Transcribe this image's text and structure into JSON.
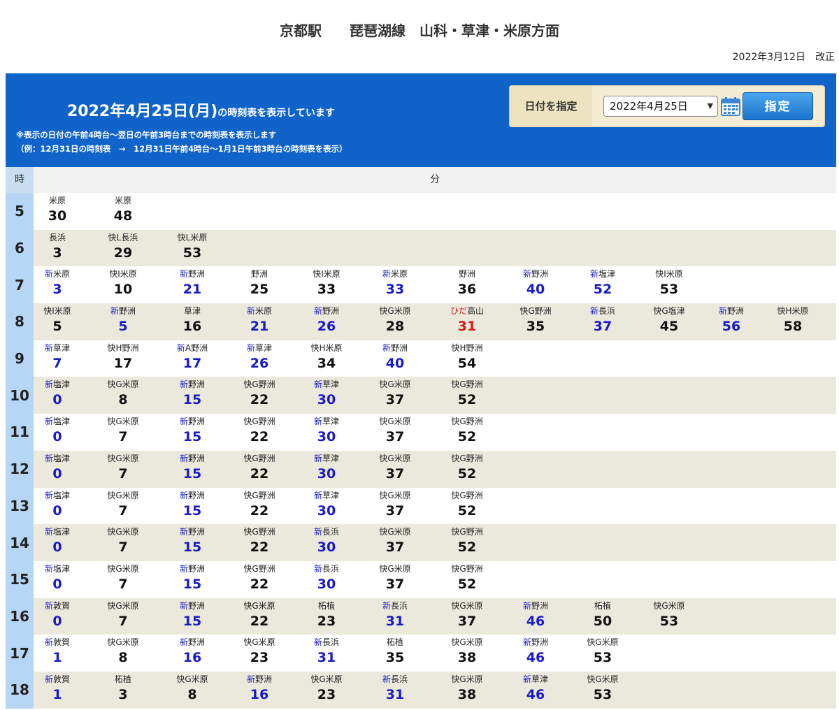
{
  "header": {
    "title": "京都駅　　琵琶湖線　山科・草津・米原方面",
    "revised": "2022年3月12日　改正"
  },
  "banner": {
    "date_big": "2022年4月25日(月)",
    "date_suffix": "の時刻表を表示しています",
    "note1": "※表示の日付の午前4時台〜翌日の午前3時台までの時刻表を表示します",
    "note2": "（例：12月31日の時刻表　→　12月31日午前4時台〜1月1日午前3時台の時刻表を表示）",
    "date_label": "日付を指定",
    "selected_date": "2022年4月25日",
    "submit_label": "指定",
    "calendar_icon": "calendar-icon"
  },
  "table": {
    "hour_header": "時",
    "minute_header": "分",
    "rows": [
      {
        "hour": "5",
        "trains": [
          {
            "pre": "",
            "dest": "米原",
            "min": "30",
            "c": ""
          },
          {
            "pre": "",
            "dest": "米原",
            "min": "48",
            "c": ""
          }
        ]
      },
      {
        "hour": "6",
        "trains": [
          {
            "pre": "",
            "dest": "長浜",
            "min": "3",
            "c": ""
          },
          {
            "pre": "",
            "dest": "快L長浜",
            "min": "29",
            "c": ""
          },
          {
            "pre": "",
            "dest": "快L米原",
            "min": "53",
            "c": ""
          }
        ]
      },
      {
        "hour": "7",
        "trains": [
          {
            "pre": "新",
            "dest": "米原",
            "min": "3",
            "c": "blue"
          },
          {
            "pre": "",
            "dest": "快I米原",
            "min": "10",
            "c": ""
          },
          {
            "pre": "新",
            "dest": "野洲",
            "min": "21",
            "c": "blue"
          },
          {
            "pre": "",
            "dest": "野洲",
            "min": "25",
            "c": ""
          },
          {
            "pre": "",
            "dest": "快I米原",
            "min": "33",
            "c": ""
          },
          {
            "pre": "新",
            "dest": "米原",
            "min": "33",
            "c": "blue"
          },
          {
            "pre": "",
            "dest": "野洲",
            "min": "36",
            "c": ""
          },
          {
            "pre": "新",
            "dest": "野洲",
            "min": "40",
            "c": "blue"
          },
          {
            "pre": "新",
            "dest": "塩津",
            "min": "52",
            "c": "blue"
          },
          {
            "pre": "",
            "dest": "快I米原",
            "min": "53",
            "c": ""
          }
        ]
      },
      {
        "hour": "8",
        "trains": [
          {
            "pre": "",
            "dest": "快I米原",
            "min": "5",
            "c": ""
          },
          {
            "pre": "新",
            "dest": "野洲",
            "min": "5",
            "c": "blue"
          },
          {
            "pre": "",
            "dest": "草津",
            "min": "16",
            "c": ""
          },
          {
            "pre": "新",
            "dest": "米原",
            "min": "21",
            "c": "blue"
          },
          {
            "pre": "新",
            "dest": "野洲",
            "min": "26",
            "c": "blue"
          },
          {
            "pre": "",
            "dest": "快G米原",
            "min": "28",
            "c": ""
          },
          {
            "pre": "ひだ",
            "dest": "高山",
            "min": "31",
            "c": "red"
          },
          {
            "pre": "",
            "dest": "快G野洲",
            "min": "35",
            "c": ""
          },
          {
            "pre": "新",
            "dest": "長浜",
            "min": "37",
            "c": "blue"
          },
          {
            "pre": "",
            "dest": "快G塩津",
            "min": "45",
            "c": ""
          },
          {
            "pre": "新",
            "dest": "野洲",
            "min": "56",
            "c": "blue"
          },
          {
            "pre": "",
            "dest": "快H米原",
            "min": "58",
            "c": ""
          }
        ]
      },
      {
        "hour": "9",
        "trains": [
          {
            "pre": "新",
            "dest": "草津",
            "min": "7",
            "c": "blue"
          },
          {
            "pre": "",
            "dest": "快H野洲",
            "min": "17",
            "c": ""
          },
          {
            "pre": "新",
            "dest": "A野洲",
            "min": "17",
            "c": "blue"
          },
          {
            "pre": "新",
            "dest": "草津",
            "min": "26",
            "c": "blue"
          },
          {
            "pre": "",
            "dest": "快H米原",
            "min": "34",
            "c": ""
          },
          {
            "pre": "新",
            "dest": "野洲",
            "min": "40",
            "c": "blue"
          },
          {
            "pre": "",
            "dest": "快H野洲",
            "min": "54",
            "c": ""
          }
        ]
      },
      {
        "hour": "10",
        "trains": [
          {
            "pre": "新",
            "dest": "塩津",
            "min": "0",
            "c": "blue"
          },
          {
            "pre": "",
            "dest": "快G米原",
            "min": "8",
            "c": ""
          },
          {
            "pre": "新",
            "dest": "野洲",
            "min": "15",
            "c": "blue"
          },
          {
            "pre": "",
            "dest": "快G野洲",
            "min": "22",
            "c": ""
          },
          {
            "pre": "新",
            "dest": "草津",
            "min": "30",
            "c": "blue"
          },
          {
            "pre": "",
            "dest": "快G米原",
            "min": "37",
            "c": ""
          },
          {
            "pre": "",
            "dest": "快G野洲",
            "min": "52",
            "c": ""
          }
        ]
      },
      {
        "hour": "11",
        "trains": [
          {
            "pre": "新",
            "dest": "塩津",
            "min": "0",
            "c": "blue"
          },
          {
            "pre": "",
            "dest": "快G米原",
            "min": "7",
            "c": ""
          },
          {
            "pre": "新",
            "dest": "野洲",
            "min": "15",
            "c": "blue"
          },
          {
            "pre": "",
            "dest": "快G野洲",
            "min": "22",
            "c": ""
          },
          {
            "pre": "新",
            "dest": "草津",
            "min": "30",
            "c": "blue"
          },
          {
            "pre": "",
            "dest": "快G米原",
            "min": "37",
            "c": ""
          },
          {
            "pre": "",
            "dest": "快G野洲",
            "min": "52",
            "c": ""
          }
        ]
      },
      {
        "hour": "12",
        "trains": [
          {
            "pre": "新",
            "dest": "塩津",
            "min": "0",
            "c": "blue"
          },
          {
            "pre": "",
            "dest": "快G米原",
            "min": "7",
            "c": ""
          },
          {
            "pre": "新",
            "dest": "野洲",
            "min": "15",
            "c": "blue"
          },
          {
            "pre": "",
            "dest": "快G野洲",
            "min": "22",
            "c": ""
          },
          {
            "pre": "新",
            "dest": "草津",
            "min": "30",
            "c": "blue"
          },
          {
            "pre": "",
            "dest": "快G米原",
            "min": "37",
            "c": ""
          },
          {
            "pre": "",
            "dest": "快G野洲",
            "min": "52",
            "c": ""
          }
        ]
      },
      {
        "hour": "13",
        "trains": [
          {
            "pre": "新",
            "dest": "塩津",
            "min": "0",
            "c": "blue"
          },
          {
            "pre": "",
            "dest": "快G米原",
            "min": "7",
            "c": ""
          },
          {
            "pre": "新",
            "dest": "野洲",
            "min": "15",
            "c": "blue"
          },
          {
            "pre": "",
            "dest": "快G野洲",
            "min": "22",
            "c": ""
          },
          {
            "pre": "新",
            "dest": "草津",
            "min": "30",
            "c": "blue"
          },
          {
            "pre": "",
            "dest": "快G米原",
            "min": "37",
            "c": ""
          },
          {
            "pre": "",
            "dest": "快G野洲",
            "min": "52",
            "c": ""
          }
        ]
      },
      {
        "hour": "14",
        "trains": [
          {
            "pre": "新",
            "dest": "塩津",
            "min": "0",
            "c": "blue"
          },
          {
            "pre": "",
            "dest": "快G米原",
            "min": "7",
            "c": ""
          },
          {
            "pre": "新",
            "dest": "野洲",
            "min": "15",
            "c": "blue"
          },
          {
            "pre": "",
            "dest": "快G野洲",
            "min": "22",
            "c": ""
          },
          {
            "pre": "新",
            "dest": "長浜",
            "min": "30",
            "c": "blue"
          },
          {
            "pre": "",
            "dest": "快G米原",
            "min": "37",
            "c": ""
          },
          {
            "pre": "",
            "dest": "快G野洲",
            "min": "52",
            "c": ""
          }
        ]
      },
      {
        "hour": "15",
        "trains": [
          {
            "pre": "新",
            "dest": "塩津",
            "min": "0",
            "c": "blue"
          },
          {
            "pre": "",
            "dest": "快G米原",
            "min": "7",
            "c": ""
          },
          {
            "pre": "新",
            "dest": "野洲",
            "min": "15",
            "c": "blue"
          },
          {
            "pre": "",
            "dest": "快G野洲",
            "min": "22",
            "c": ""
          },
          {
            "pre": "新",
            "dest": "長浜",
            "min": "30",
            "c": "blue"
          },
          {
            "pre": "",
            "dest": "快G米原",
            "min": "37",
            "c": ""
          },
          {
            "pre": "",
            "dest": "快G野洲",
            "min": "52",
            "c": ""
          }
        ]
      },
      {
        "hour": "16",
        "trains": [
          {
            "pre": "新",
            "dest": "敦賀",
            "min": "0",
            "c": "blue"
          },
          {
            "pre": "",
            "dest": "快G米原",
            "min": "7",
            "c": ""
          },
          {
            "pre": "新",
            "dest": "野洲",
            "min": "15",
            "c": "blue"
          },
          {
            "pre": "",
            "dest": "快G米原",
            "min": "22",
            "c": ""
          },
          {
            "pre": "",
            "dest": "柘植",
            "min": "23",
            "c": ""
          },
          {
            "pre": "新",
            "dest": "長浜",
            "min": "31",
            "c": "blue"
          },
          {
            "pre": "",
            "dest": "快G米原",
            "min": "37",
            "c": ""
          },
          {
            "pre": "新",
            "dest": "野洲",
            "min": "46",
            "c": "blue"
          },
          {
            "pre": "",
            "dest": "柘植",
            "min": "50",
            "c": ""
          },
          {
            "pre": "",
            "dest": "快G米原",
            "min": "53",
            "c": ""
          }
        ]
      },
      {
        "hour": "17",
        "trains": [
          {
            "pre": "新",
            "dest": "敦賀",
            "min": "1",
            "c": "blue"
          },
          {
            "pre": "",
            "dest": "快G米原",
            "min": "8",
            "c": ""
          },
          {
            "pre": "新",
            "dest": "野洲",
            "min": "16",
            "c": "blue"
          },
          {
            "pre": "",
            "dest": "快G米原",
            "min": "23",
            "c": ""
          },
          {
            "pre": "新",
            "dest": "長浜",
            "min": "31",
            "c": "blue"
          },
          {
            "pre": "",
            "dest": "柘植",
            "min": "35",
            "c": ""
          },
          {
            "pre": "",
            "dest": "快G米原",
            "min": "38",
            "c": ""
          },
          {
            "pre": "新",
            "dest": "野洲",
            "min": "46",
            "c": "blue"
          },
          {
            "pre": "",
            "dest": "快G米原",
            "min": "53",
            "c": ""
          }
        ]
      },
      {
        "hour": "18",
        "trains": [
          {
            "pre": "新",
            "dest": "敦賀",
            "min": "1",
            "c": "blue"
          },
          {
            "pre": "",
            "dest": "柘植",
            "min": "3",
            "c": ""
          },
          {
            "pre": "",
            "dest": "快G米原",
            "min": "8",
            "c": ""
          },
          {
            "pre": "新",
            "dest": "野洲",
            "min": "16",
            "c": "blue"
          },
          {
            "pre": "",
            "dest": "快G米原",
            "min": "23",
            "c": ""
          },
          {
            "pre": "新",
            "dest": "長浜",
            "min": "31",
            "c": "blue"
          },
          {
            "pre": "",
            "dest": "快G米原",
            "min": "38",
            "c": ""
          },
          {
            "pre": "新",
            "dest": "草津",
            "min": "46",
            "c": "blue"
          },
          {
            "pre": "",
            "dest": "快G米原",
            "min": "53",
            "c": ""
          }
        ]
      }
    ]
  }
}
